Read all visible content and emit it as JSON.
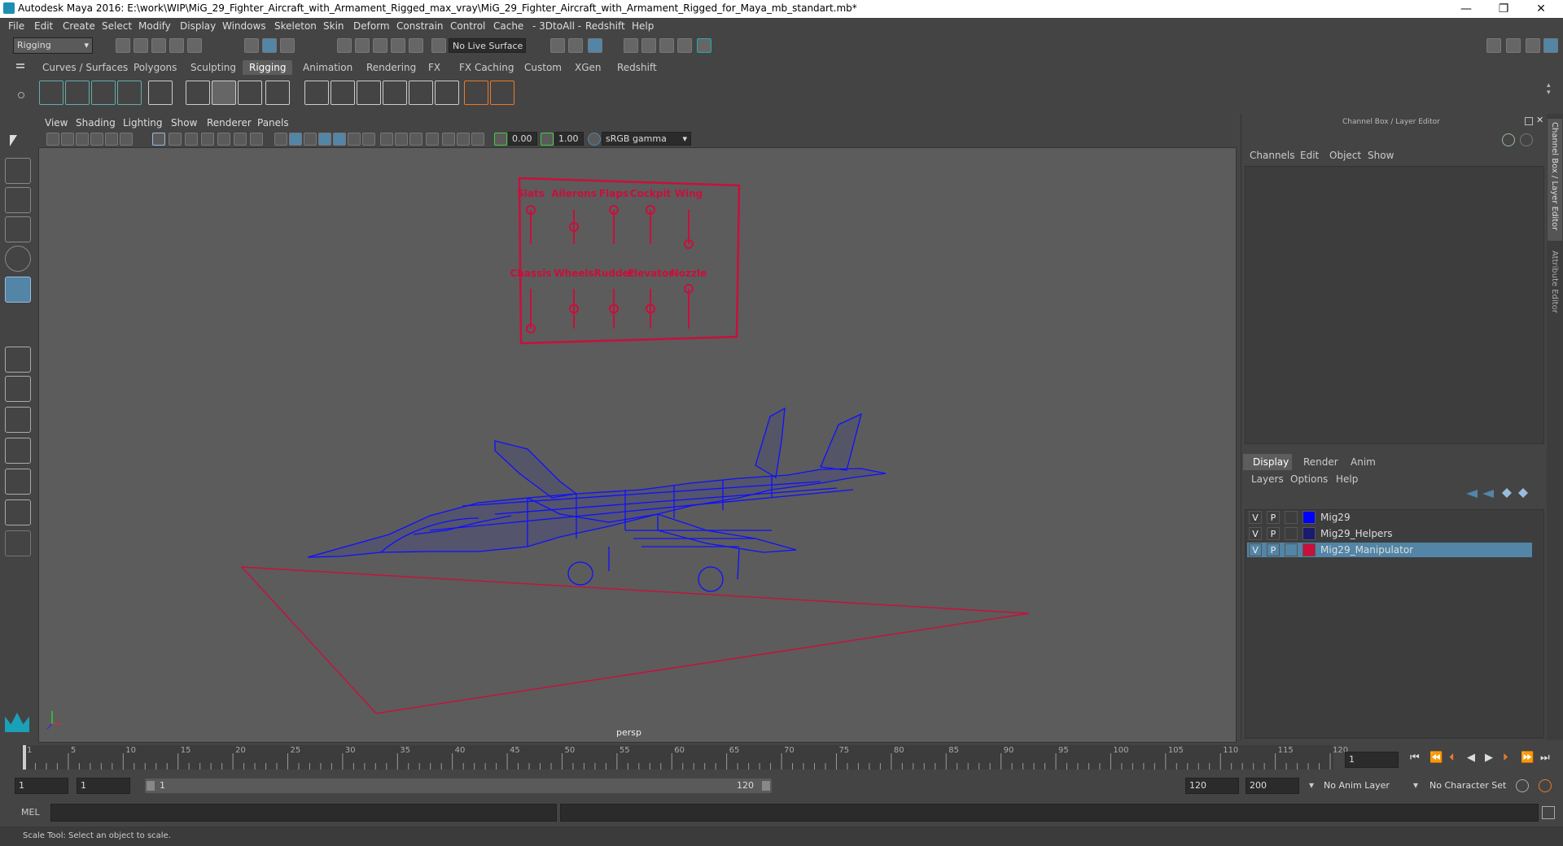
{
  "window": {
    "title": "Autodesk Maya 2016: E:\\work\\WIP\\MiG_29_Fighter_Aircraft_with_Armament_Rigged_max_vray\\MiG_29_Fighter_Aircraft_with_Armament_Rigged_for_Maya_mb_standart.mb*",
    "minimize": "—",
    "maximize": "❐",
    "close": "✕"
  },
  "menubar": [
    "File",
    "Edit",
    "Create",
    "Select",
    "Modify",
    "Display",
    "Windows",
    "Skeleton",
    "Skin",
    "Deform",
    "Constrain",
    "Control",
    "Cache",
    "- 3DtoAll -",
    "Redshift",
    "Help"
  ],
  "status_line": {
    "mode": "Rigging",
    "live_surface": "No Live Surface"
  },
  "shelf_tabs": [
    "Curves / Surfaces",
    "Polygons",
    "Sculpting",
    "Rigging",
    "Animation",
    "Rendering",
    "FX",
    "FX Caching",
    "Custom",
    "XGen",
    "Redshift"
  ],
  "active_shelf_tab": "Rigging",
  "viewport": {
    "menu": [
      "View",
      "Shading",
      "Lighting",
      "Show",
      "Renderer",
      "Panels"
    ],
    "exposure": "0.00",
    "gamma": "1.00",
    "color_space": "sRGB gamma",
    "camera_label": "persp",
    "rig_panel": {
      "top_labels": [
        "Slats",
        "Ailerons",
        "Flaps",
        "Cockpit",
        "Wing"
      ],
      "bottom_labels": [
        "Chassis",
        "Wheels",
        "Rudder",
        "Elevator",
        "Nozzle"
      ],
      "color": "#c8103c"
    },
    "wire_color": "#1010ff"
  },
  "channel_box": {
    "title": "Channel Box / Layer Editor",
    "menu": [
      "Channels",
      "Edit",
      "Object",
      "Show"
    ],
    "layer_tabs": [
      "Display",
      "Render",
      "Anim"
    ],
    "active_layer_tab": "Display",
    "layer_menu": [
      "Layers",
      "Options",
      "Help"
    ],
    "layers": [
      {
        "v": "V",
        "p": "P",
        "name": "Mig29",
        "color": "#0000ff",
        "selected": false
      },
      {
        "v": "V",
        "p": "P",
        "name": "Mig29_Helpers",
        "color": "#1a1a6e",
        "selected": false
      },
      {
        "v": "V",
        "p": "P",
        "name": "Mig29_Manipulator",
        "color": "#c8103c",
        "selected": true
      }
    ],
    "side_tabs": [
      "Channel Box / Layer Editor",
      "Attribute Editor"
    ]
  },
  "timeline": {
    "ticks": [
      "1",
      "5",
      "10",
      "15",
      "20",
      "25",
      "30",
      "35",
      "40",
      "45",
      "50",
      "55",
      "60",
      "65",
      "70",
      "75",
      "80",
      "85",
      "90",
      "95",
      "100",
      "105",
      "110",
      "115",
      "120"
    ],
    "current_frame": "1"
  },
  "range": {
    "start": "1",
    "playback_start": "1",
    "slider_start": "1",
    "slider_end": "120",
    "playback_end": "120",
    "end": "200",
    "anim_layer": "No Anim Layer",
    "character_set": "No Character Set"
  },
  "command_line": {
    "label": "MEL"
  },
  "help_line": "Scale Tool: Select an object to scale."
}
